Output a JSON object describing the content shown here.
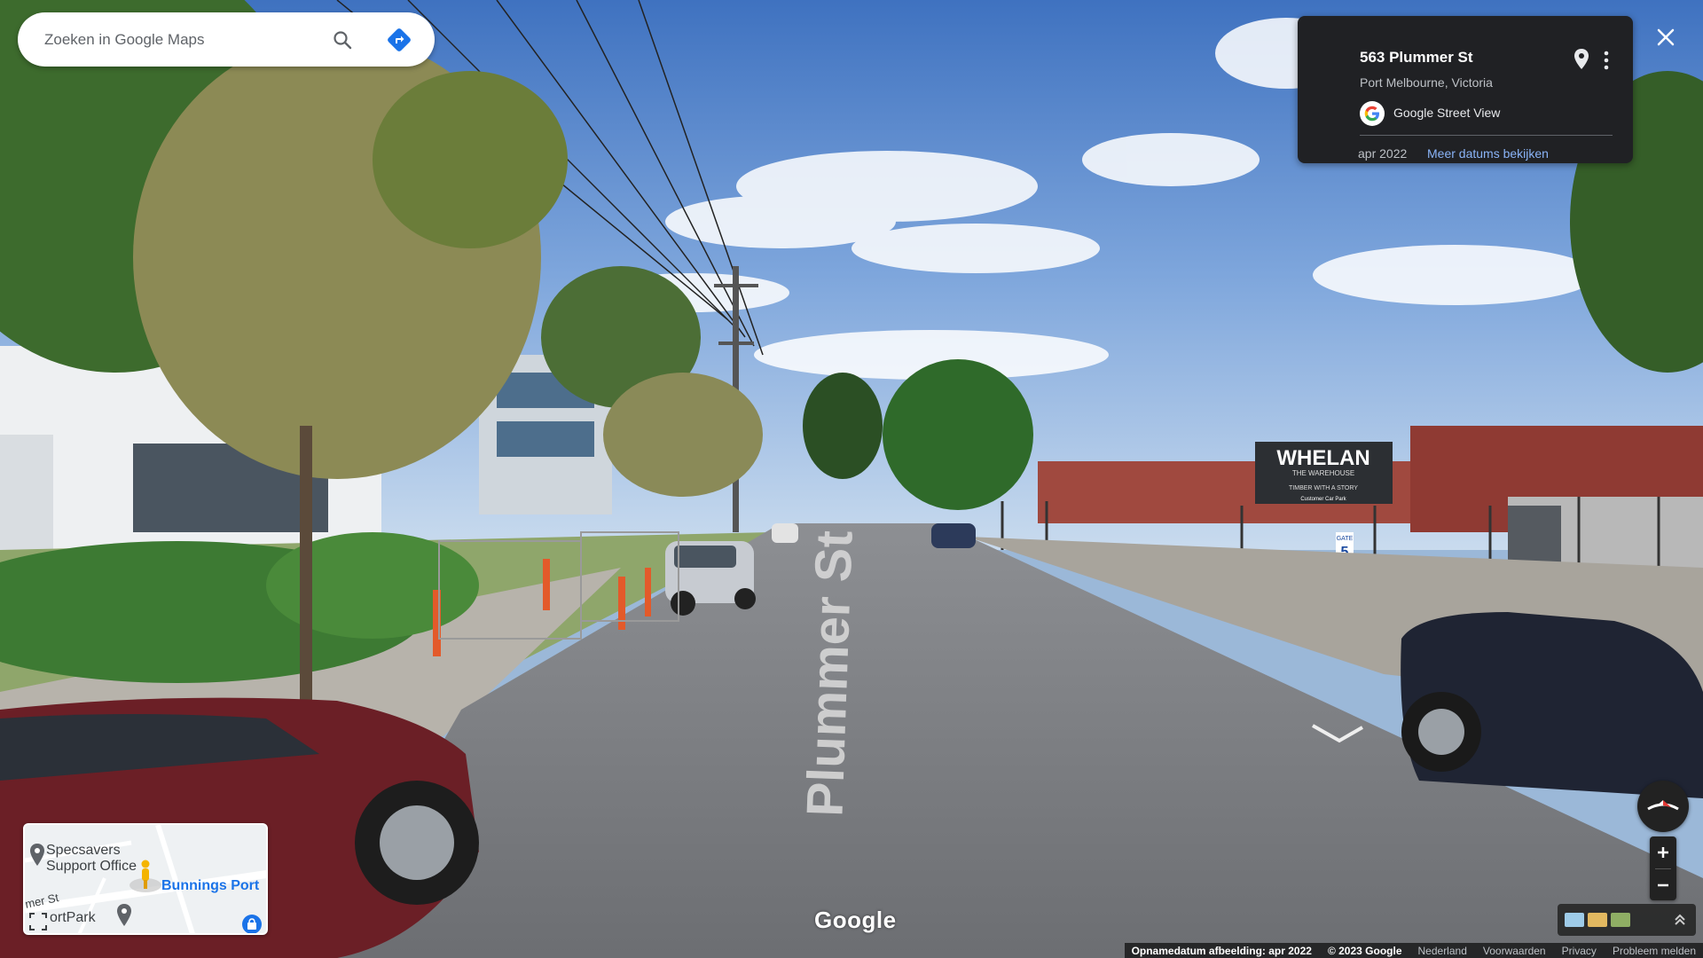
{
  "search": {
    "placeholder": "Zoeken in Google Maps"
  },
  "info_card": {
    "address": "563 Plummer St",
    "locality": "Port Melbourne, Victoria",
    "source": "Google Street View",
    "date": "apr 2022",
    "more_dates": "Meer datums bekijken"
  },
  "scene": {
    "street_label": "Plummer St",
    "sign_title": "WHELAN",
    "sign_sub1": "THE WAREHOUSE",
    "sign_sub2": "TIMBER WITH A STORY",
    "sign_sub3": "Customer Car Park",
    "gate_label": "GATE",
    "gate_number": "5"
  },
  "minimap": {
    "label_specsavers_1": "Specsavers",
    "label_specsavers_2": "Support Office",
    "label_bunnings": "Bunnings Port",
    "label_street": "mer St",
    "label_portpark": "ortPark"
  },
  "branding": {
    "google": "Google"
  },
  "footer": {
    "capture_date": "Opnamedatum afbeelding: apr 2022",
    "copyright": "© 2023 Google",
    "country": "Nederland",
    "terms": "Voorwaarden",
    "privacy": "Privacy",
    "report": "Probleem melden"
  },
  "icons": {
    "search": "search-icon",
    "directions": "directions-icon",
    "pin": "pin-icon",
    "more": "more-vert-icon",
    "close": "close-icon",
    "compass": "compass-icon",
    "zoom_in": "plus-icon",
    "zoom_out": "minus-icon",
    "expand": "expand-icon",
    "fullscreen": "fullscreen-icon"
  },
  "colors": {
    "card_bg": "#202124",
    "link": "#8ab4f8",
    "google_blue": "#1a73e8"
  }
}
